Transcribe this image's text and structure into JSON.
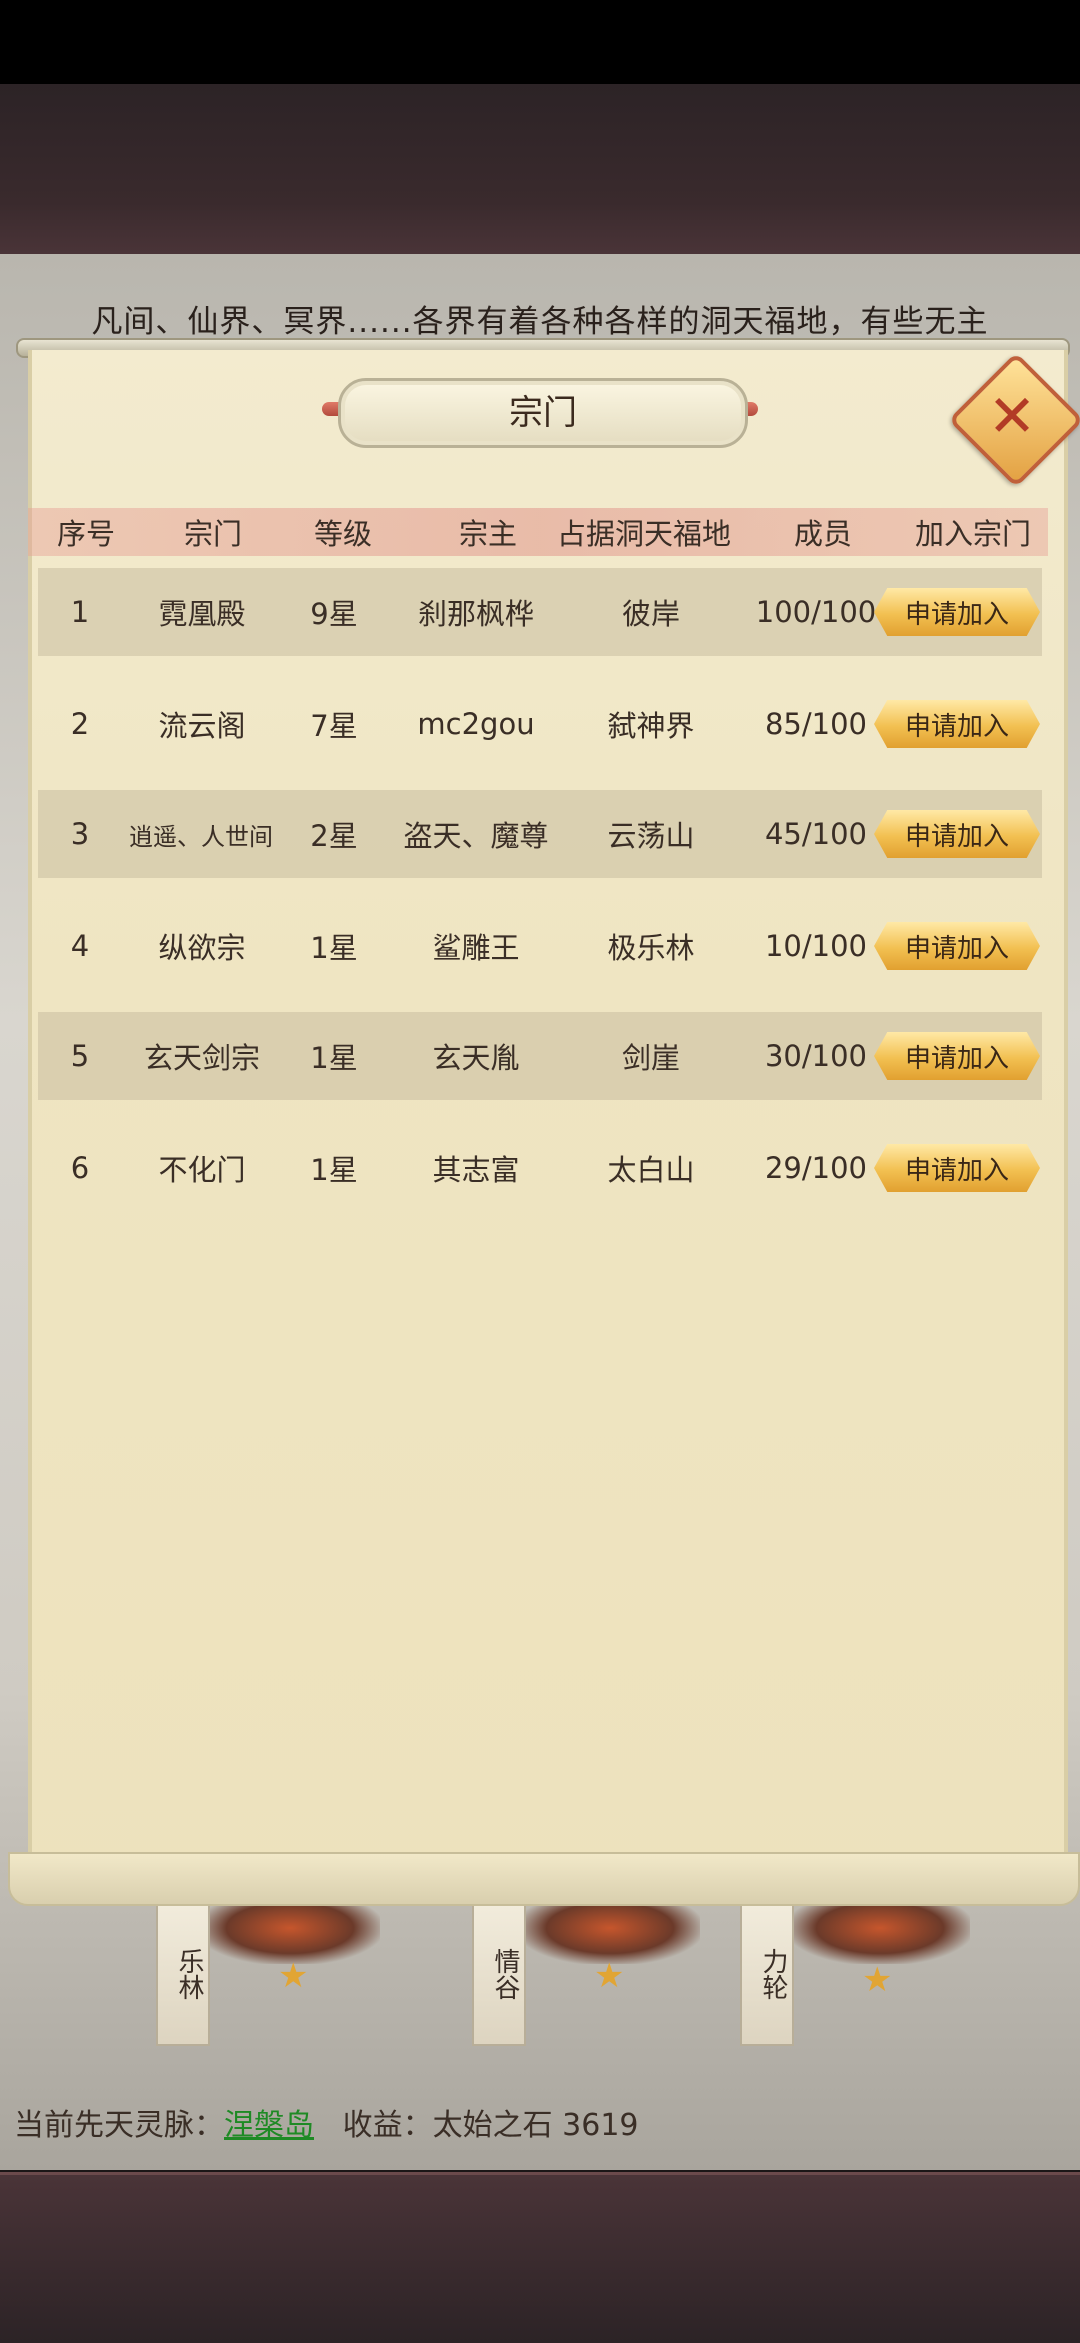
{
  "intro_text": "凡间、仙界、冥界......各界有着各种各样的洞天福地，有些无主",
  "dialog": {
    "title": "宗门",
    "columns": [
      "序号",
      "宗门",
      "等级",
      "宗主",
      "占据洞天福地",
      "成员",
      "加入宗门"
    ],
    "rows": [
      {
        "no": "1",
        "sect": "霓凰殿",
        "level": "9星",
        "leader": "刹那枫桦",
        "realm": "彼岸",
        "members": "100/100",
        "action": "申请加入"
      },
      {
        "no": "2",
        "sect": "流云阁",
        "level": "7星",
        "leader": "mc2gou",
        "realm": "弑神界",
        "members": "85/100",
        "action": "申请加入"
      },
      {
        "no": "3",
        "sect": "逍遥、人世间",
        "level": "2星",
        "leader": "盗天、魔尊",
        "realm": "云荡山",
        "members": "45/100",
        "action": "申请加入"
      },
      {
        "no": "4",
        "sect": "纵欲宗",
        "level": "1星",
        "leader": "鲨雕王",
        "realm": "极乐林",
        "members": "10/100",
        "action": "申请加入"
      },
      {
        "no": "5",
        "sect": "玄天剑宗",
        "level": "1星",
        "leader": "玄天胤",
        "realm": "剑崖",
        "members": "30/100",
        "action": "申请加入"
      },
      {
        "no": "6",
        "sect": "不化门",
        "level": "1星",
        "leader": "其志富",
        "realm": "太白山",
        "members": "29/100",
        "action": "申请加入"
      }
    ]
  },
  "map_banners": [
    "乐林",
    "情谷",
    "力轮"
  ],
  "status_bar": {
    "vein_label": "当前先天灵脉：",
    "vein_name": "涅槃岛",
    "income_label": "收益：太始之石 3619"
  }
}
